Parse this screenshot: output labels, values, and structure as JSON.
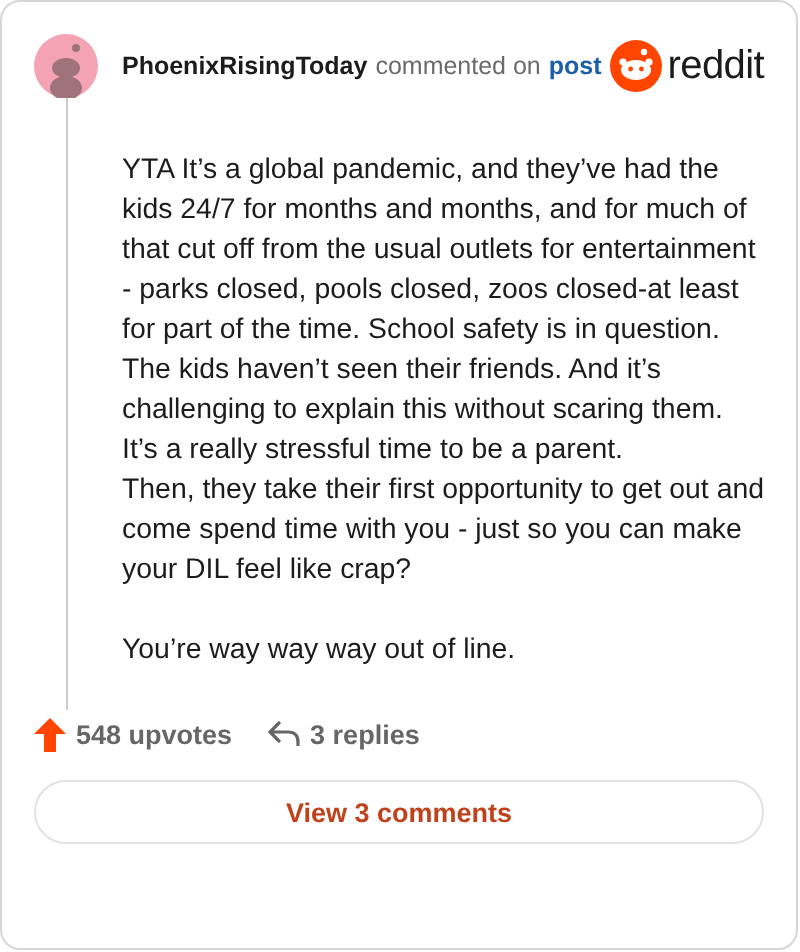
{
  "comment": {
    "author": "PhoenixRisingToday",
    "action": "commented on",
    "link": "post",
    "brand": "reddit",
    "paragraphs": [
      "YTA It’s a global pandemic, and they’ve had the kids 24/7 for months and months, and for much of that cut off from the usual outlets for entertainment - parks closed, pools closed, zoos closed-at least for part of the time. School safety is in question. The kids haven’t seen their friends. And it’s challenging to explain this without scaring them. It’s a really stressful time to be a parent.\nThen, they take their first opportunity to get out and come spend time with you - just so you can make your DIL feel like crap?",
      "You’re way way way out of line."
    ],
    "upvotes": "548 upvotes",
    "replies": "3 replies",
    "button": "View 3 comments"
  }
}
